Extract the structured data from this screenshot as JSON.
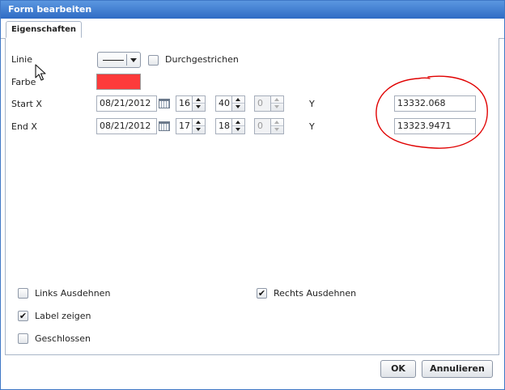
{
  "dialog": {
    "title": "Form bearbeiten"
  },
  "tabs": [
    {
      "label": "Eigenschaften"
    }
  ],
  "form": {
    "linie_label": "Linie",
    "durchgestrichen_label": "Durchgestrichen",
    "durchgestrichen_checked": false,
    "farbe_label": "Farbe",
    "farbe_color": "#fd3b3b",
    "start": {
      "label": "Start X",
      "date": "08/21/2012",
      "hour": "16",
      "minute": "40",
      "second": "0",
      "y_label": "Y",
      "y_value": "13332.068"
    },
    "end": {
      "label": "End X",
      "date": "08/21/2012",
      "hour": "17",
      "minute": "18",
      "second": "0",
      "y_label": "Y",
      "y_value": "13323.9471"
    }
  },
  "options": {
    "links_ausdehnen": {
      "label": "Links Ausdehnen",
      "checked": false
    },
    "rechts_ausdehnen": {
      "label": "Rechts Ausdehnen",
      "checked": true
    },
    "label_zeigen": {
      "label": "Label zeigen",
      "checked": true
    },
    "geschlossen": {
      "label": "Geschlossen",
      "checked": false
    }
  },
  "footer": {
    "ok_label": "OK",
    "cancel_label": "Annulieren"
  },
  "colors": {
    "titlebar": "#3f77c6",
    "annotation": "#e00000"
  }
}
